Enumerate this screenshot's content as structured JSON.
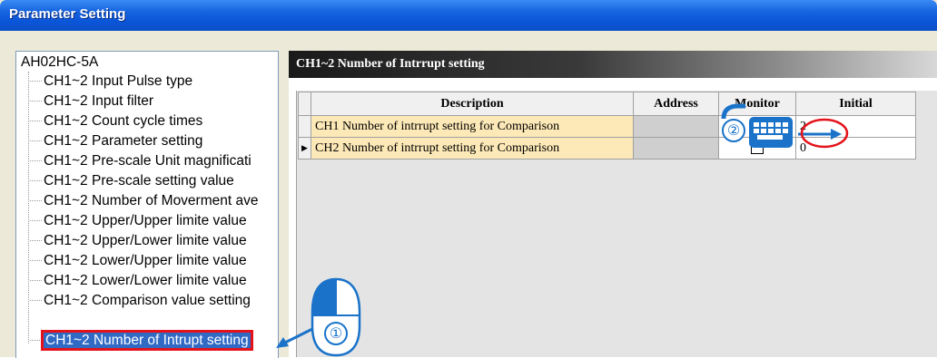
{
  "window": {
    "title": "Parameter Setting"
  },
  "tree": {
    "root": "AH02HC-5A",
    "items": [
      "CH1~2 Input Pulse type",
      "CH1~2 Input filter",
      "CH1~2 Count cycle times",
      "CH1~2 Parameter setting",
      "CH1~2 Pre-scale Unit magnificati",
      "CH1~2 Pre-scale setting value",
      "CH1~2 Number of Moverment ave",
      "CH1~2 Upper/Upper limite value",
      "CH1~2 Upper/Lower limite value",
      "CH1~2 Lower/Upper limite value",
      "CH1~2 Lower/Lower limite value",
      "CH1~2 Comparison value setting",
      "CH1~2 Number of Intrupt setting"
    ],
    "selected_index": 12
  },
  "panel": {
    "header": "CH1~2 Number of Intrrupt setting",
    "columns": [
      "Description",
      "Address",
      "Monitor",
      "Initial"
    ],
    "rows": [
      {
        "description": "CH1 Number of intrrupt setting for Comparison",
        "address": "",
        "monitor_checked": false,
        "initial": "2",
        "current": false
      },
      {
        "description": "CH2 Number of intrrupt setting for Comparison",
        "address": "",
        "monitor_checked": false,
        "initial": "0",
        "current": true
      }
    ]
  },
  "annotations": {
    "step1": "①",
    "step2": "②"
  },
  "colors": {
    "annotation_blue": "#1a73c9",
    "highlight_red": "#e4131b",
    "selection_blue": "#316ac5"
  }
}
